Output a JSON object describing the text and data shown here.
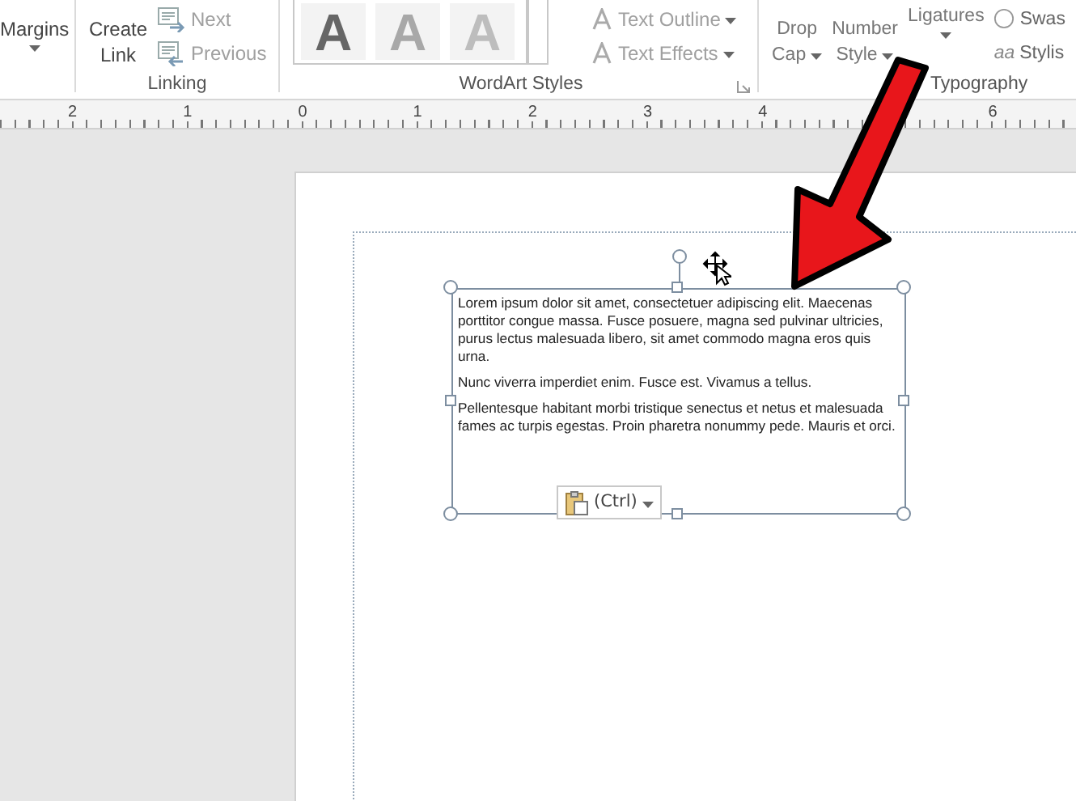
{
  "ribbon": {
    "margins": {
      "label": "Margins"
    },
    "linking": {
      "label": "Linking",
      "create_link": "Create Link",
      "items": [
        {
          "label": "Next",
          "disabled": true
        },
        {
          "label": "Previous",
          "disabled": true
        }
      ]
    },
    "wordart": {
      "label": "WordArt Styles",
      "styles": [
        "A",
        "A",
        "A"
      ],
      "items": [
        {
          "label": "Text Outline",
          "disabled": true
        },
        {
          "label": "Text Effects",
          "disabled": true
        }
      ]
    },
    "typography": {
      "label": "Typography",
      "buttons": [
        "Drop Cap",
        "Number Style",
        "Ligatures"
      ],
      "items": [
        {
          "label": "Swas"
        },
        {
          "icon": "aa",
          "label": "Stylis"
        }
      ]
    }
  },
  "ruler": {
    "segments": [
      [
        "2",
        "1",
        "0",
        "1",
        "2",
        "3",
        "4"
      ],
      [
        "6"
      ]
    ]
  },
  "textbox": {
    "paragraphs": [
      "Lorem ipsum dolor sit amet, consectetuer adipiscing elit. Maecenas porttitor congue massa. Fusce posuere, magna sed pulvinar ultricies, purus lectus malesuada libero, sit amet commodo magna eros quis urna.",
      "Nunc viverra imperdiet enim. Fusce est. Vivamus a tellus.",
      "Pellentesque habitant morbi tristique senectus et netus et malesuada fames ac turpis egestas. Proin pharetra nonummy pede. Mauris et orci."
    ],
    "paste_options": "(Ctrl)"
  }
}
